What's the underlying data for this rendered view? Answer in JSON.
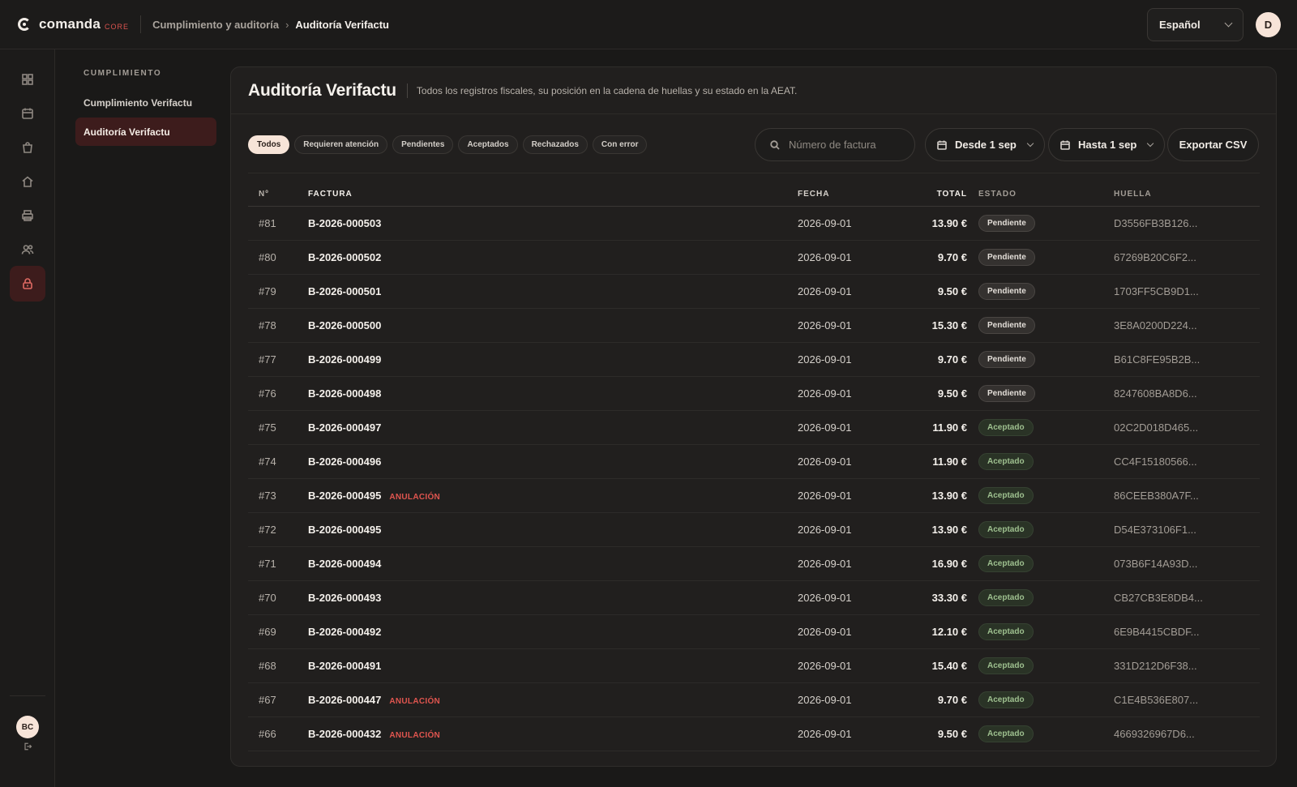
{
  "brand": {
    "name": "comanda",
    "tag": "CORE"
  },
  "breadcrumb": {
    "parent": "Cumplimiento y auditoría",
    "separator": "›",
    "current": "Auditoría Verifactu"
  },
  "language": {
    "selected": "Español"
  },
  "user": {
    "initial": "D",
    "org_initials": "BC"
  },
  "subnav": {
    "heading": "CUMPLIMIENTO",
    "items": [
      {
        "label": "Cumplimiento Verifactu",
        "active": false
      },
      {
        "label": "Auditoría Verifactu",
        "active": true
      }
    ]
  },
  "page": {
    "title": "Auditoría Verifactu",
    "subtitle": "Todos los registros fiscales, su posición en la cadena de huellas y su estado en la AEAT."
  },
  "filters": [
    {
      "label": "Todos",
      "active": true
    },
    {
      "label": "Requieren atención",
      "active": false
    },
    {
      "label": "Pendientes",
      "active": false
    },
    {
      "label": "Aceptados",
      "active": false
    },
    {
      "label": "Rechazados",
      "active": false
    },
    {
      "label": "Con error",
      "active": false
    }
  ],
  "search": {
    "placeholder": "Número de factura"
  },
  "date_from": {
    "label": "Desde 1 sep"
  },
  "date_to": {
    "label": "Hasta 1 sep"
  },
  "export": {
    "label": "Exportar CSV"
  },
  "table": {
    "columns": {
      "num": "Nº",
      "factura": "FACTURA",
      "fecha": "FECHA",
      "total": "TOTAL",
      "estado": "ESTADO",
      "huella": "HUELLA"
    },
    "anulacion_label": "ANULACIÓN",
    "rows": [
      {
        "num": "#81",
        "factura": "B-2026-000503",
        "anulacion": false,
        "fecha": "2026-09-01",
        "total": "13.90 €",
        "estado": "Pendiente",
        "huella": "D3556FB3B126..."
      },
      {
        "num": "#80",
        "factura": "B-2026-000502",
        "anulacion": false,
        "fecha": "2026-09-01",
        "total": "9.70 €",
        "estado": "Pendiente",
        "huella": "67269B20C6F2..."
      },
      {
        "num": "#79",
        "factura": "B-2026-000501",
        "anulacion": false,
        "fecha": "2026-09-01",
        "total": "9.50 €",
        "estado": "Pendiente",
        "huella": "1703FF5CB9D1..."
      },
      {
        "num": "#78",
        "factura": "B-2026-000500",
        "anulacion": false,
        "fecha": "2026-09-01",
        "total": "15.30 €",
        "estado": "Pendiente",
        "huella": "3E8A0200D224..."
      },
      {
        "num": "#77",
        "factura": "B-2026-000499",
        "anulacion": false,
        "fecha": "2026-09-01",
        "total": "9.70 €",
        "estado": "Pendiente",
        "huella": "B61C8FE95B2B..."
      },
      {
        "num": "#76",
        "factura": "B-2026-000498",
        "anulacion": false,
        "fecha": "2026-09-01",
        "total": "9.50 €",
        "estado": "Pendiente",
        "huella": "8247608BA8D6..."
      },
      {
        "num": "#75",
        "factura": "B-2026-000497",
        "anulacion": false,
        "fecha": "2026-09-01",
        "total": "11.90 €",
        "estado": "Aceptado",
        "huella": "02C2D018D465..."
      },
      {
        "num": "#74",
        "factura": "B-2026-000496",
        "anulacion": false,
        "fecha": "2026-09-01",
        "total": "11.90 €",
        "estado": "Aceptado",
        "huella": "CC4F15180566..."
      },
      {
        "num": "#73",
        "factura": "B-2026-000495",
        "anulacion": true,
        "fecha": "2026-09-01",
        "total": "13.90 €",
        "estado": "Aceptado",
        "huella": "86CEEB380A7F..."
      },
      {
        "num": "#72",
        "factura": "B-2026-000495",
        "anulacion": false,
        "fecha": "2026-09-01",
        "total": "13.90 €",
        "estado": "Aceptado",
        "huella": "D54E373106F1..."
      },
      {
        "num": "#71",
        "factura": "B-2026-000494",
        "anulacion": false,
        "fecha": "2026-09-01",
        "total": "16.90 €",
        "estado": "Aceptado",
        "huella": "073B6F14A93D..."
      },
      {
        "num": "#70",
        "factura": "B-2026-000493",
        "anulacion": false,
        "fecha": "2026-09-01",
        "total": "33.30 €",
        "estado": "Aceptado",
        "huella": "CB27CB3E8DB4..."
      },
      {
        "num": "#69",
        "factura": "B-2026-000492",
        "anulacion": false,
        "fecha": "2026-09-01",
        "total": "12.10 €",
        "estado": "Aceptado",
        "huella": "6E9B4415CBDF..."
      },
      {
        "num": "#68",
        "factura": "B-2026-000491",
        "anulacion": false,
        "fecha": "2026-09-01",
        "total": "15.40 €",
        "estado": "Aceptado",
        "huella": "331D212D6F38..."
      },
      {
        "num": "#67",
        "factura": "B-2026-000447",
        "anulacion": true,
        "fecha": "2026-09-01",
        "total": "9.70 €",
        "estado": "Aceptado",
        "huella": "C1E4B536E807..."
      },
      {
        "num": "#66",
        "factura": "B-2026-000432",
        "anulacion": true,
        "fecha": "2026-09-01",
        "total": "9.50 €",
        "estado": "Aceptado",
        "huella": "4669326967D6..."
      }
    ]
  },
  "rail_icons": [
    "dashboard-icon",
    "calendar-icon",
    "bag-icon",
    "home-icon",
    "printer-icon",
    "users-icon",
    "lock-icon",
    "logout-icon"
  ],
  "colors": {
    "accent": "#e06a63",
    "active_bg": "#3d1c1c",
    "anulacion": "#e0554f",
    "accepted": "#9ec08f"
  }
}
